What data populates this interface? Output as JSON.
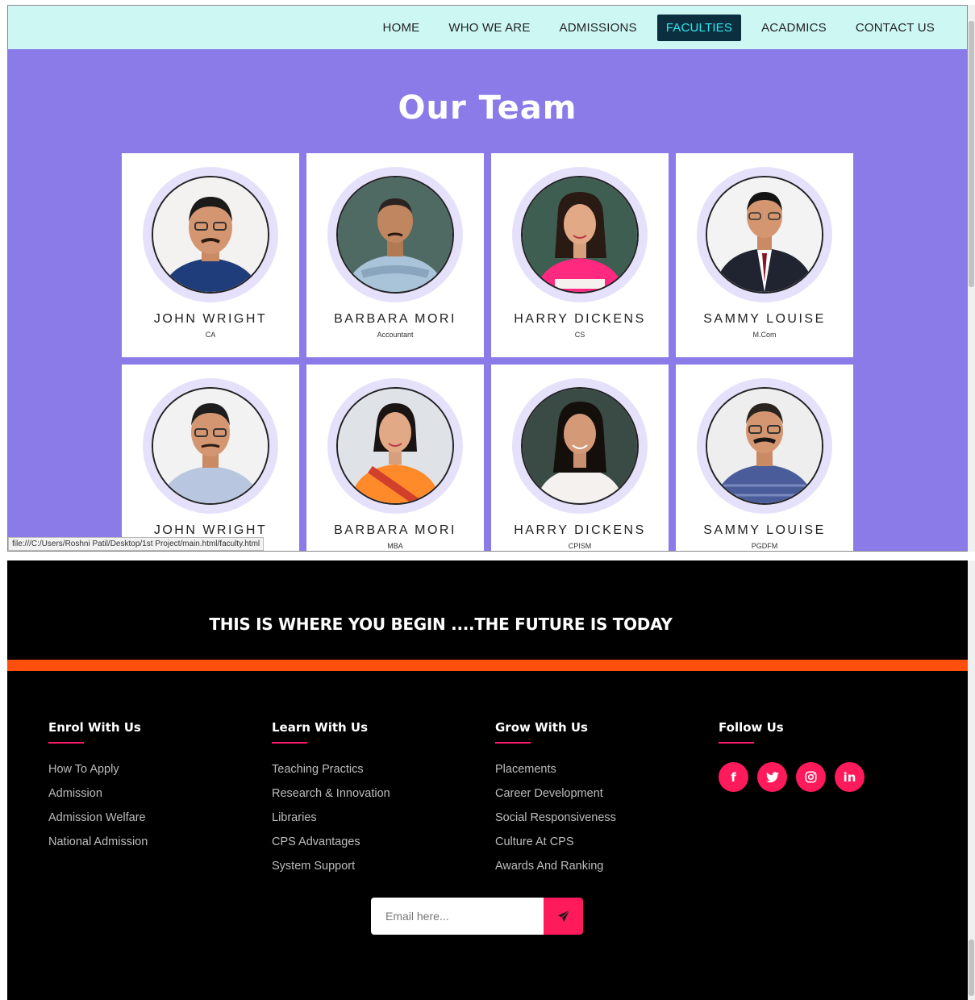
{
  "nav": {
    "items": [
      "HOME",
      "WHO WE ARE",
      "ADMISSIONS",
      "FACULTIES",
      "ACADMICS",
      "CONTACT US"
    ],
    "active": "FACULTIES"
  },
  "team": {
    "title": "Our Team",
    "members": [
      {
        "name": "JOHN WRIGHT",
        "role": "CA"
      },
      {
        "name": "BARBARA MORI",
        "role": "Accountant"
      },
      {
        "name": "HARRY DICKENS",
        "role": "CS"
      },
      {
        "name": "SAMMY LOUISE",
        "role": "M.Com"
      },
      {
        "name": "JOHN WRIGHT",
        "role": ""
      },
      {
        "name": "BARBARA MORI",
        "role": "MBA"
      },
      {
        "name": "HARRY DICKENS",
        "role": "CPISM"
      },
      {
        "name": "SAMMY LOUISE",
        "role": "PGDFM"
      }
    ]
  },
  "status_bar": {
    "url": "file:///C:/Users/Roshni Patil/Desktop/1st Project/main.html/faculty.html"
  },
  "footer": {
    "tagline": "THIS IS WHERE YOU BEGIN ....THE FUTURE IS TODAY",
    "columns": [
      {
        "heading": "Enrol With Us",
        "links": [
          "How To Apply",
          "Admission",
          "Admission Welfare",
          "National Admission"
        ]
      },
      {
        "heading": "Learn With Us",
        "links": [
          "Teaching Practics",
          "Research & Innovation",
          "Libraries",
          "CPS Advantages",
          "System Support"
        ]
      },
      {
        "heading": "Grow With Us",
        "links": [
          "Placements",
          "Career Development",
          "Social Responsiveness",
          "Culture At CPS",
          "Awards And Ranking"
        ]
      }
    ],
    "follow": {
      "heading": "Follow Us",
      "icons": [
        {
          "name": "facebook-icon",
          "glyph": "f"
        },
        {
          "name": "twitter-icon",
          "glyph": "🐦"
        },
        {
          "name": "instagram-icon",
          "glyph": "◎"
        },
        {
          "name": "linkedin-icon",
          "glyph": "in"
        }
      ]
    },
    "subscribe": {
      "placeholder": "Email here..."
    }
  },
  "colors": {
    "accent": "#ff1a5c",
    "team_bg": "#8b7be8",
    "nav_bg": "#ccf7f3",
    "orange": "#ff4f0d"
  }
}
